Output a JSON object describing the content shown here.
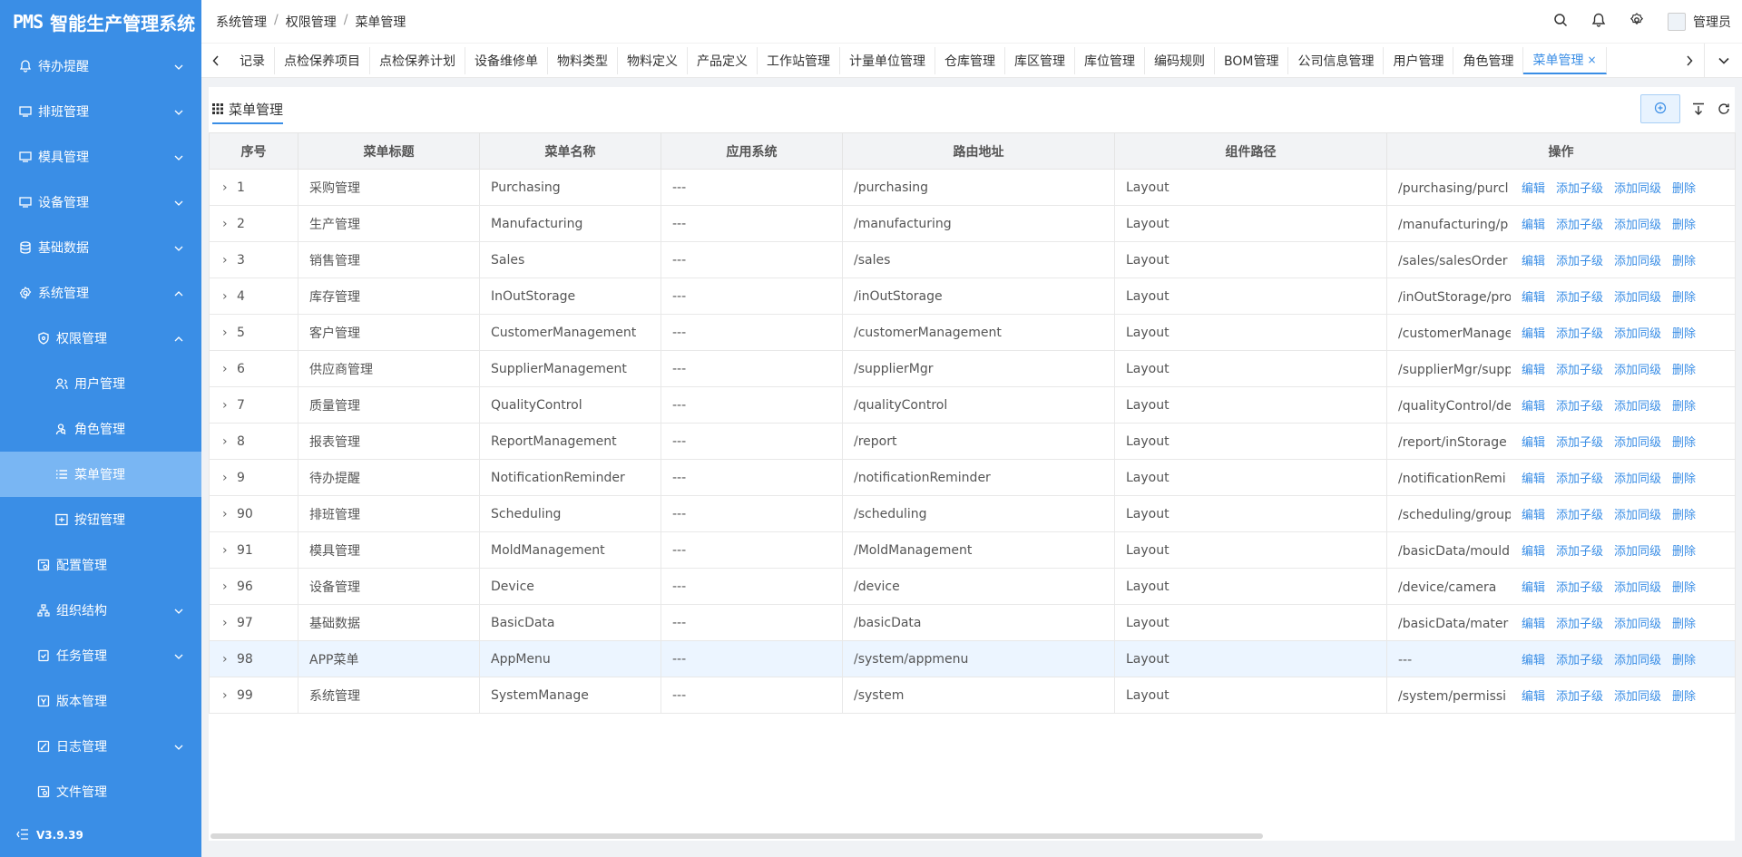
{
  "app": {
    "logo": "PMS",
    "title": "智能生产管理系统",
    "version": "V3.9.39"
  },
  "sidebar": {
    "items": [
      {
        "label": "待办提醒"
      },
      {
        "label": "排班管理"
      },
      {
        "label": "模具管理"
      },
      {
        "label": "设备管理"
      },
      {
        "label": "基础数据"
      },
      {
        "label": "系统管理"
      },
      {
        "label": "权限管理"
      },
      {
        "label": "用户管理"
      },
      {
        "label": "角色管理"
      },
      {
        "label": "菜单管理"
      },
      {
        "label": "按钮管理"
      },
      {
        "label": "配置管理"
      },
      {
        "label": "组织结构"
      },
      {
        "label": "任务管理"
      },
      {
        "label": "版本管理"
      },
      {
        "label": "日志管理"
      },
      {
        "label": "文件管理"
      }
    ]
  },
  "header": {
    "breadcrumb": [
      "系统管理",
      "权限管理",
      "菜单管理"
    ],
    "user": "管理员"
  },
  "tabs": [
    {
      "label": "记录"
    },
    {
      "label": "点检保养项目"
    },
    {
      "label": "点检保养计划"
    },
    {
      "label": "设备维修单"
    },
    {
      "label": "物料类型"
    },
    {
      "label": "物料定义"
    },
    {
      "label": "产品定义"
    },
    {
      "label": "工作站管理"
    },
    {
      "label": "计量单位管理"
    },
    {
      "label": "仓库管理"
    },
    {
      "label": "库区管理"
    },
    {
      "label": "库位管理"
    },
    {
      "label": "编码规则"
    },
    {
      "label": "BOM管理"
    },
    {
      "label": "公司信息管理"
    },
    {
      "label": "用户管理"
    },
    {
      "label": "角色管理"
    },
    {
      "label": "菜单管理",
      "close": "×"
    }
  ],
  "panel": {
    "title": "菜单管理"
  },
  "table": {
    "headers": [
      "序号",
      "菜单标题",
      "菜单名称",
      "应用系统",
      "路由地址",
      "组件路径",
      "操作"
    ],
    "actions": [
      "编辑",
      "添加子级",
      "添加同级",
      "删除"
    ],
    "rows": [
      {
        "id": "1",
        "title": "采购管理",
        "name": "Purchasing",
        "app": "---",
        "route": "/purchasing",
        "component": "Layout",
        "redirect": "/purchasing/purcl"
      },
      {
        "id": "2",
        "title": "生产管理",
        "name": "Manufacturing",
        "app": "---",
        "route": "/manufacturing",
        "component": "Layout",
        "redirect": "/manufacturing/p"
      },
      {
        "id": "3",
        "title": "销售管理",
        "name": "Sales",
        "app": "---",
        "route": "/sales",
        "component": "Layout",
        "redirect": "/sales/salesOrder"
      },
      {
        "id": "4",
        "title": "库存管理",
        "name": "InOutStorage",
        "app": "---",
        "route": "/inOutStorage",
        "component": "Layout",
        "redirect": "/inOutStorage/pro"
      },
      {
        "id": "5",
        "title": "客户管理",
        "name": "CustomerManagement",
        "app": "---",
        "route": "/customerManagement",
        "component": "Layout",
        "redirect": "/customerManage"
      },
      {
        "id": "6",
        "title": "供应商管理",
        "name": "SupplierManagement",
        "app": "---",
        "route": "/supplierMgr",
        "component": "Layout",
        "redirect": "/supplierMgr/supp"
      },
      {
        "id": "7",
        "title": "质量管理",
        "name": "QualityControl",
        "app": "---",
        "route": "/qualityControl",
        "component": "Layout",
        "redirect": "/qualityControl/de"
      },
      {
        "id": "8",
        "title": "报表管理",
        "name": "ReportManagement",
        "app": "---",
        "route": "/report",
        "component": "Layout",
        "redirect": "/report/inStorage"
      },
      {
        "id": "9",
        "title": "待办提醒",
        "name": "NotificationReminder",
        "app": "---",
        "route": "/notificationReminder",
        "component": "Layout",
        "redirect": "/notificationRemi"
      },
      {
        "id": "90",
        "title": "排班管理",
        "name": "Scheduling",
        "app": "---",
        "route": "/scheduling",
        "component": "Layout",
        "redirect": "/scheduling/group"
      },
      {
        "id": "91",
        "title": "模具管理",
        "name": "MoldManagement",
        "app": "---",
        "route": "/MoldManagement",
        "component": "Layout",
        "redirect": "/basicData/mould"
      },
      {
        "id": "96",
        "title": "设备管理",
        "name": "Device",
        "app": "---",
        "route": "/device",
        "component": "Layout",
        "redirect": "/device/camera"
      },
      {
        "id": "97",
        "title": "基础数据",
        "name": "BasicData",
        "app": "---",
        "route": "/basicData",
        "component": "Layout",
        "redirect": "/basicData/mater"
      },
      {
        "id": "98",
        "title": "APP菜单",
        "name": "AppMenu",
        "app": "---",
        "route": "/system/appmenu",
        "component": "Layout",
        "redirect": "---"
      },
      {
        "id": "99",
        "title": "系统管理",
        "name": "SystemManage",
        "app": "---",
        "route": "/system",
        "component": "Layout",
        "redirect": "/system/permissi"
      }
    ]
  },
  "colors": {
    "primary": "#3a8ee6",
    "sidebar_active": "#79b6f3",
    "row_highlight": "#ecf5ff"
  }
}
